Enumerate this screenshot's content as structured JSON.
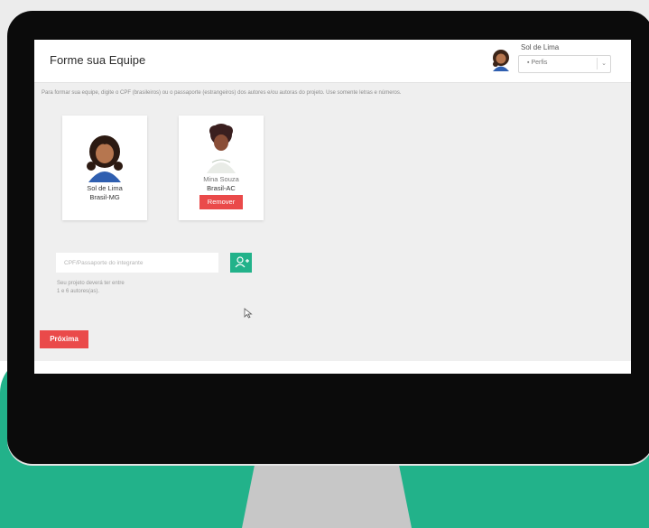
{
  "header": {
    "title": "Forme sua Equipe",
    "user_name": "Sol de Lima",
    "profile_select": "Perfis"
  },
  "instructions": "Para formar sua equipe, digite o CPF (brasileiros) ou o passaporte (estrangeiros) dos autores e/ou autoras do projeto. Use somente letras e números.",
  "members": [
    {
      "name": "Sol de Lima",
      "location": "Brasil-MG"
    },
    {
      "name": "Mina Souza",
      "location": "Brasil-AC",
      "remove_label": "Remover"
    }
  ],
  "cpf_input": {
    "placeholder": "CPF/Passaporte do integrante"
  },
  "hint": [
    "Seu projeto deverá ter entre",
    "1 e 6 autores(as)."
  ],
  "next_label": "Próxima",
  "icons": {
    "add": "add-user-icon",
    "cursor": "mouse-pointer-icon",
    "caret": "chevron-down-icon"
  },
  "colors": {
    "accent_green": "#22b28a",
    "accent_red": "#ea4a4a"
  }
}
